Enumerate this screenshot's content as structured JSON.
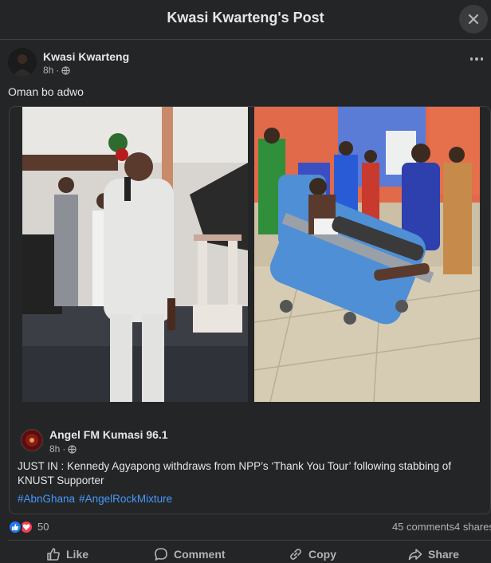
{
  "header": {
    "title": "Kwasi Kwarteng's Post"
  },
  "post": {
    "author": "Kwasi Kwarteng",
    "time": "8h",
    "privacy_icon": "globe-icon",
    "text": "Oman bo adwo"
  },
  "shared": {
    "page_name": "Angel FM Kumasi 96.1",
    "time": "8h",
    "text": "JUST IN : Kennedy Agyapong withdraws from NPP’s ‘Thank You Tour’ following stabbing of KNUST Supporter",
    "hashtags": [
      "#AbnGhana",
      "#AngelRockMixture"
    ]
  },
  "stats": {
    "reactions": "50",
    "comments": "45 comments",
    "shares": "4 shares"
  },
  "actions": {
    "like": "Like",
    "comment": "Comment",
    "copy": "Copy",
    "share": "Share"
  },
  "colors": {
    "background": "#242526",
    "text": "#e4e6eb",
    "secondary": "#b0b3b8",
    "link": "#4599ff",
    "like": "#2078f4",
    "love": "#f33e58"
  }
}
